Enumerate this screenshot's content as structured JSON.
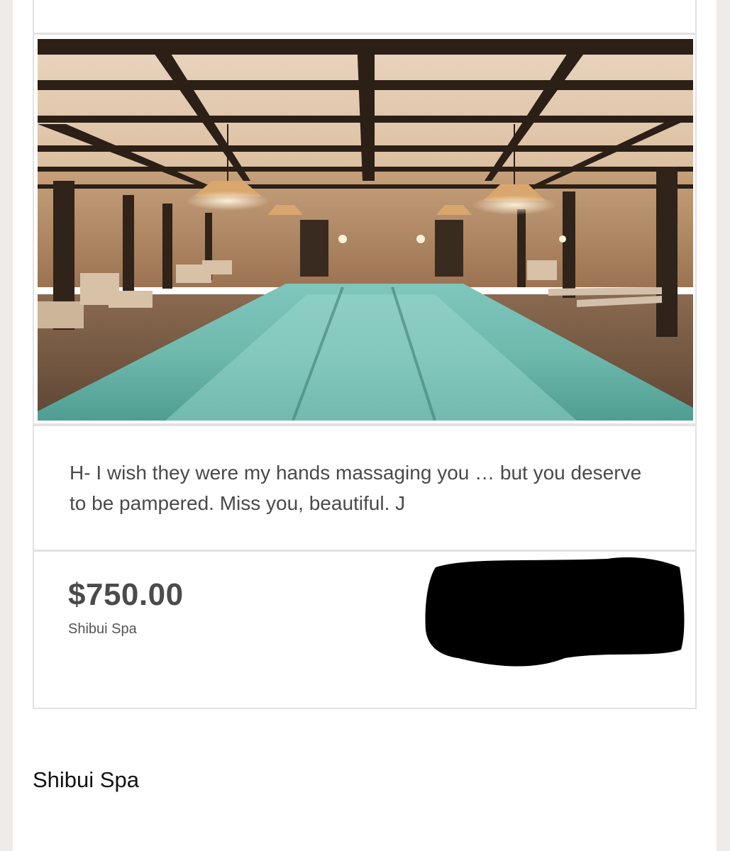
{
  "gift_card": {
    "image_alt": "indoor pool with timber-beamed ceiling and lounge chairs",
    "message": "H- I wish they were my hands massaging you … but you deserve to be pampered. Miss you, beautiful. J",
    "amount": "$750.00",
    "merchant": "Shibui Spa",
    "barcode": "redacted-barcode"
  },
  "footer": {
    "merchant_name": "Shibui Spa"
  }
}
